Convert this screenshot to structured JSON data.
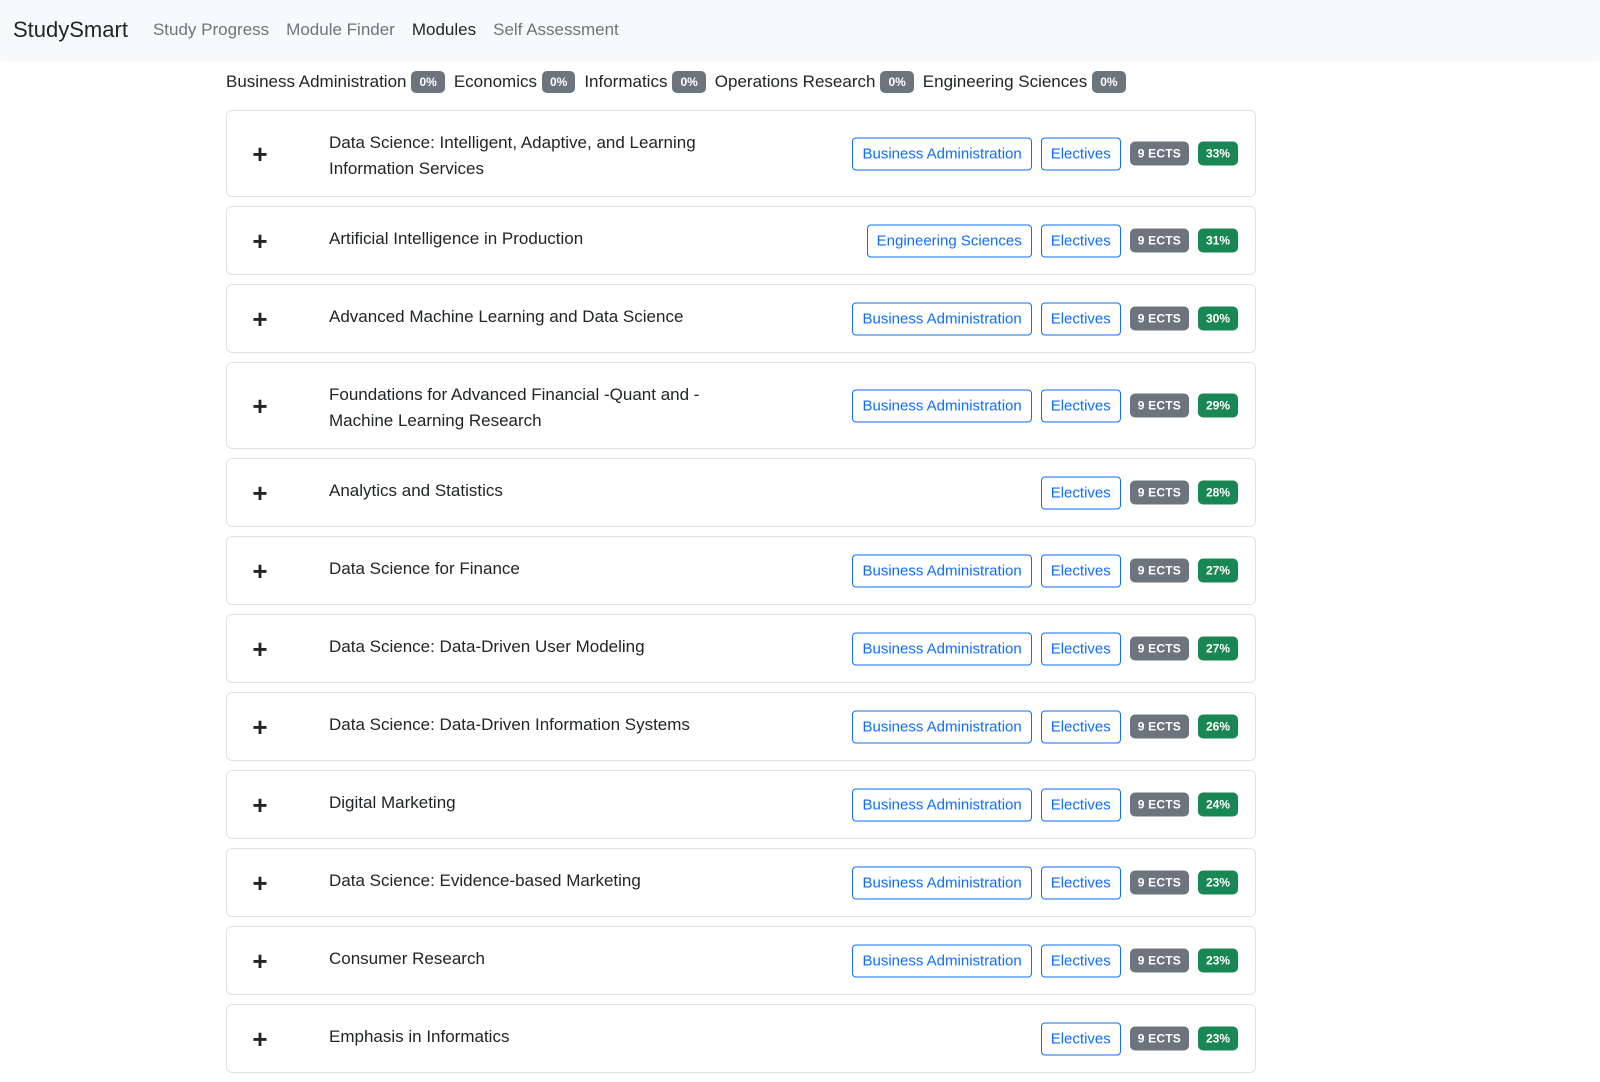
{
  "navbar": {
    "brand": "StudySmart",
    "links": [
      {
        "label": "Study Progress",
        "active": false
      },
      {
        "label": "Module Finder",
        "active": false
      },
      {
        "label": "Modules",
        "active": true
      },
      {
        "label": "Self Assessment",
        "active": false
      }
    ]
  },
  "filters": [
    {
      "label": "Business Administration",
      "percent": "0%"
    },
    {
      "label": "Economics",
      "percent": "0%"
    },
    {
      "label": "Informatics",
      "percent": "0%"
    },
    {
      "label": "Operations Research",
      "percent": "0%"
    },
    {
      "label": "Engineering Sciences",
      "percent": "0%"
    }
  ],
  "expand_symbol": "+",
  "modules": [
    {
      "title": "Data Science: Intelligent, Adaptive, and Learning Information Services",
      "tags": [
        "Business Administration",
        "Electives"
      ],
      "ects": "9 ECTS",
      "score": "33%",
      "tall": true
    },
    {
      "title": "Artificial Intelligence in Production",
      "tags": [
        "Engineering Sciences",
        "Electives"
      ],
      "ects": "9 ECTS",
      "score": "31%",
      "tall": false
    },
    {
      "title": "Advanced Machine Learning and Data Science",
      "tags": [
        "Business Administration",
        "Electives"
      ],
      "ects": "9 ECTS",
      "score": "30%",
      "tall": false
    },
    {
      "title": "Foundations for Advanced Financial -Quant and -Machine Learning Research",
      "tags": [
        "Business Administration",
        "Electives"
      ],
      "ects": "9 ECTS",
      "score": "29%",
      "tall": true
    },
    {
      "title": "Analytics and Statistics",
      "tags": [
        "Electives"
      ],
      "ects": "9 ECTS",
      "score": "28%",
      "tall": false
    },
    {
      "title": "Data Science for Finance",
      "tags": [
        "Business Administration",
        "Electives"
      ],
      "ects": "9 ECTS",
      "score": "27%",
      "tall": false
    },
    {
      "title": "Data Science: Data-Driven User Modeling",
      "tags": [
        "Business Administration",
        "Electives"
      ],
      "ects": "9 ECTS",
      "score": "27%",
      "tall": false
    },
    {
      "title": "Data Science: Data-Driven Information Systems",
      "tags": [
        "Business Administration",
        "Electives"
      ],
      "ects": "9 ECTS",
      "score": "26%",
      "tall": false
    },
    {
      "title": "Digital Marketing",
      "tags": [
        "Business Administration",
        "Electives"
      ],
      "ects": "9 ECTS",
      "score": "24%",
      "tall": false
    },
    {
      "title": "Data Science: Evidence-based Marketing",
      "tags": [
        "Business Administration",
        "Electives"
      ],
      "ects": "9 ECTS",
      "score": "23%",
      "tall": false
    },
    {
      "title": "Consumer Research",
      "tags": [
        "Business Administration",
        "Electives"
      ],
      "ects": "9 ECTS",
      "score": "23%",
      "tall": false
    },
    {
      "title": "Emphasis in Informatics",
      "tags": [
        "Electives"
      ],
      "ects": "9 ECTS",
      "score": "23%",
      "tall": false
    }
  ]
}
